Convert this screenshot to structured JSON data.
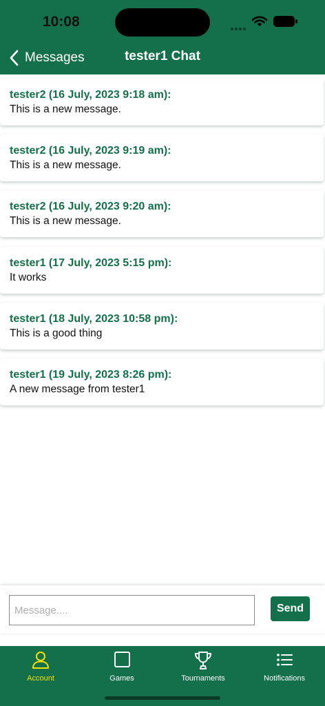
{
  "status_bar": {
    "time": "10:08"
  },
  "nav": {
    "back_label": "Messages",
    "title": "tester1 Chat"
  },
  "messages": [
    {
      "sender": "tester2 (16 July, 2023 9:18 am):",
      "text": "This is a new message."
    },
    {
      "sender": "tester2 (16 July, 2023 9:19 am):",
      "text": "This is a new message."
    },
    {
      "sender": "tester2 (16 July, 2023 9:20 am):",
      "text": "This is a new message."
    },
    {
      "sender": "tester1 (17 July, 2023 5:15 pm):",
      "text": "It works"
    },
    {
      "sender": "tester1 (18 July, 2023 10:58 pm):",
      "text": "This is a good thing"
    },
    {
      "sender": "tester1 (19 July, 2023 8:26 pm):",
      "text": "A new message from tester1"
    }
  ],
  "compose": {
    "value": "",
    "placeholder": "Message....",
    "send_label": "Send"
  },
  "tabbar": {
    "items": [
      {
        "label": "Account",
        "icon": "person-icon",
        "active": true
      },
      {
        "label": "Games",
        "icon": "square-icon",
        "active": false
      },
      {
        "label": "Tournaments",
        "icon": "trophy-icon",
        "active": false
      },
      {
        "label": "Notifications",
        "icon": "list-icon",
        "active": false
      }
    ]
  },
  "colors": {
    "primary": "#14704a",
    "active_tab": "#f5e000",
    "sender_text": "#14704a"
  }
}
